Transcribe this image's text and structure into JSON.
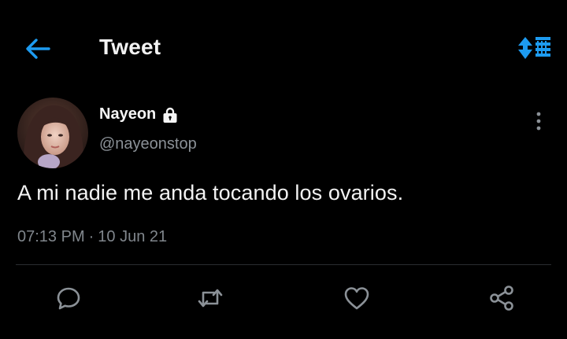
{
  "header": {
    "title": "Tweet",
    "back_icon": "arrow-left-icon",
    "sort_icon": "sort-arrows-icon",
    "accent_color": "#1d9bf0"
  },
  "author": {
    "display_name": "Nayeon",
    "handle": "@nayeonstop",
    "protected_icon": "lock-icon",
    "more_icon": "more-vertical-icon"
  },
  "tweet": {
    "text": "A mi nadie me anda tocando los ovarios.",
    "time": "07:13 PM",
    "separator": "·",
    "date": "10 Jun 21"
  },
  "actions": [
    {
      "name": "reply",
      "icon": "reply-icon"
    },
    {
      "name": "retweet",
      "icon": "retweet-icon"
    },
    {
      "name": "like",
      "icon": "heart-icon"
    },
    {
      "name": "share",
      "icon": "share-icon"
    }
  ],
  "colors": {
    "background": "#000000",
    "text": "#f3f3f3",
    "secondary_text": "#8b9197",
    "divider": "#2a2d31",
    "icon_gray": "#8b9197"
  }
}
